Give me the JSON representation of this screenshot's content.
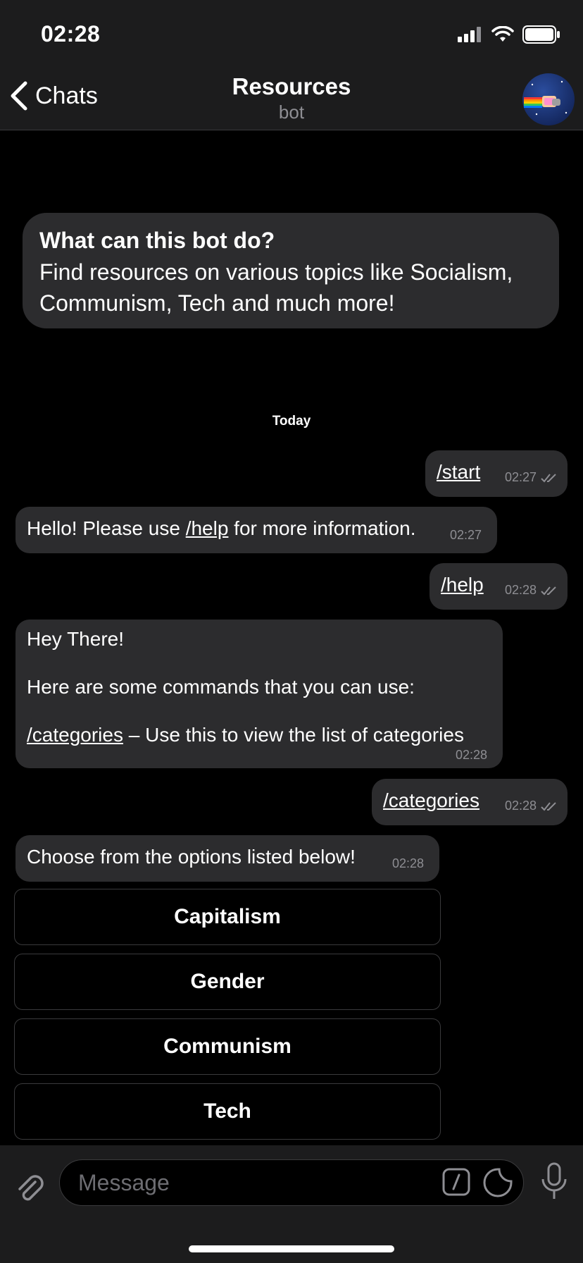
{
  "status": {
    "time": "02:28"
  },
  "header": {
    "back_label": "Chats",
    "title": "Resources",
    "subtitle": "bot"
  },
  "info": {
    "heading": "What can this bot do?",
    "body": "Find resources on various topics like Socialism, Communism, Tech and much more!"
  },
  "date_label": "Today",
  "messages": [
    {
      "dir": "out",
      "text": "/start",
      "time": "02:27"
    },
    {
      "dir": "in",
      "text_before": "Hello! Please use ",
      "link": "/help",
      "text_after": " for more information.",
      "time": "02:27"
    },
    {
      "dir": "out",
      "text": "/help",
      "time": "02:28"
    },
    {
      "dir": "in",
      "line1": "Hey There!",
      "line2": "Here are some commands that you can use:",
      "link": "/categories",
      "line3_rest": " – Use this to view the list of categories",
      "time": "02:28"
    },
    {
      "dir": "out",
      "text": "/categories",
      "time": "02:28"
    },
    {
      "dir": "in",
      "text": "Choose from the options listed below!",
      "time": "02:28"
    }
  ],
  "keyboard": [
    "Capitalism",
    "Gender",
    "Communism",
    "Tech"
  ],
  "composer": {
    "placeholder": "Message"
  }
}
